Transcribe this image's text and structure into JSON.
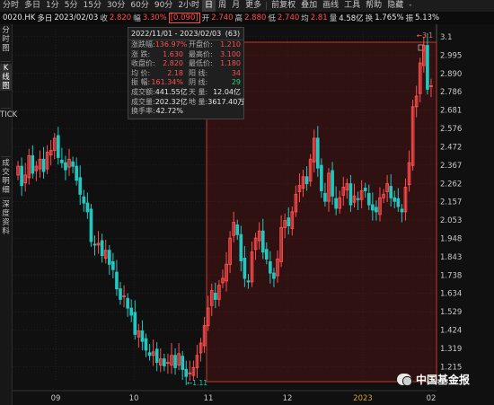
{
  "toolbar": {
    "items": [
      "分时",
      "多日",
      "1分",
      "5分",
      "15分",
      "30分",
      "60分",
      "90分",
      "2小时",
      "日",
      "周",
      "月",
      "更多"
    ],
    "selected_index": 9,
    "right_items": [
      "前复权",
      "叠加",
      "画线",
      "工具",
      "帮助",
      "隐藏"
    ],
    "hide_arrow": "-"
  },
  "infobar": {
    "code": "0020.HK",
    "mode": "多日",
    "date": "2023/02/03",
    "close_label": "收",
    "close": "2.820",
    "change_label": "幅",
    "change": "3.30%",
    "change_amt": "[0.090]",
    "open_label": "开",
    "open": "2.740",
    "high_label": "高",
    "high": "2.880",
    "low_label": "低",
    "low": "2.740",
    "avg_label": "均",
    "avg": "2.81",
    "vol_label": "量",
    "vol": "4.58亿",
    "turnover_label": "换",
    "turnover": "1.765%",
    "amp_label": "振",
    "amp": "5.13%"
  },
  "sidebar": {
    "tabs": [
      {
        "label": "分时图"
      },
      {
        "label": "K线图",
        "active": true
      },
      {
        "label": "TICK"
      },
      {
        "label": "成交明细"
      },
      {
        "label": "深度资料"
      }
    ]
  },
  "tooltip": {
    "range": "2022/11/01 - 2023/02/03",
    "count": "(63)",
    "rows": [
      [
        {
          "label": "涨跌幅:",
          "value": "136.97%",
          "c": "red"
        },
        {
          "label": "开盘价:",
          "value": "1.210",
          "c": "red"
        }
      ],
      [
        {
          "label": "涨  跌:",
          "value": "1.630",
          "c": "red"
        },
        {
          "label": "最高价:",
          "value": "3.100",
          "c": "red"
        }
      ],
      [
        {
          "label": "收盘价:",
          "value": "2.820",
          "c": "red"
        },
        {
          "label": "最低价:",
          "value": "1.180",
          "c": "red"
        }
      ],
      [
        {
          "label": "均  价:",
          "value": "2.18",
          "c": "red"
        },
        {
          "label": "阳  线:",
          "value": "34",
          "c": "red"
        }
      ],
      [
        {
          "label": "振  幅:",
          "value": "161.34%",
          "c": "red"
        },
        {
          "label": "阴  线:",
          "value": "29",
          "c": "grn"
        }
      ],
      [
        {
          "label": "成交额:",
          "value": "441.55亿",
          "c": "wht"
        },
        {
          "label": "天  量:",
          "value": "12.04亿",
          "c": "wht"
        }
      ],
      [
        {
          "label": "成交量:",
          "value": "202.32亿",
          "c": "wht"
        },
        {
          "label": "地  量:",
          "value": "3617.40万",
          "c": "wht"
        }
      ],
      [
        {
          "label": "换手率:",
          "value": "42.72%",
          "c": "wht"
        }
      ]
    ]
  },
  "watermark": {
    "text": "中国基金报"
  },
  "colors": {
    "up": "#ff4d4d",
    "down": "#22c8c0",
    "selection": "#c0392b",
    "grid": "#2a2a2a"
  },
  "chart_data": {
    "type": "candlestick",
    "y_ticks": [
      "3.1",
      "2.995",
      "2.890",
      "2.786",
      "2.681",
      "2.576",
      "2.472",
      "2.367",
      "2.262",
      "2.157",
      "2.053",
      "1.948",
      "1.843",
      "1.738",
      "1.634",
      "1.529",
      "1.424",
      "1.319",
      "1.215"
    ],
    "x_ticks": [
      "09",
      "10",
      "11",
      "12",
      "2023",
      "02"
    ],
    "high_marker": "3.1",
    "low_marker": "1.11",
    "selection_range": [
      "2022/11/01",
      "2023/02/03"
    ],
    "series": [
      {
        "name": "close",
        "values": [
          2.36,
          2.25,
          2.31,
          2.42,
          2.32,
          2.36,
          2.4,
          2.33,
          2.44,
          2.45,
          2.52,
          2.41,
          2.38,
          2.34,
          2.4,
          2.36,
          2.28,
          2.2,
          2.15,
          2.1,
          1.93,
          1.91,
          1.92,
          1.85,
          1.88,
          1.8,
          1.77,
          1.66,
          1.6,
          1.62,
          1.55,
          1.51,
          1.4,
          1.42,
          1.36,
          1.31,
          1.28,
          1.3,
          1.24,
          1.26,
          1.22,
          1.24,
          1.28,
          1.21,
          1.29,
          1.2,
          1.16,
          1.18,
          1.21,
          1.28,
          1.35,
          1.45,
          1.55,
          1.65,
          1.6,
          1.68,
          1.72,
          1.8,
          1.95,
          2.04,
          1.97,
          1.82,
          1.72,
          1.7,
          1.87,
          1.95,
          1.99,
          1.87,
          1.83,
          1.75,
          1.72,
          1.83,
          2.01,
          2.05,
          2.02,
          2.1,
          2.2,
          2.25,
          2.3,
          2.26,
          2.4,
          2.52,
          2.35,
          2.22,
          2.16,
          2.32,
          2.19,
          2.12,
          2.18,
          2.24,
          2.26,
          2.14,
          2.19,
          2.17,
          2.22,
          2.22,
          2.14,
          2.11,
          2.1,
          2.18,
          2.2,
          2.26,
          2.18,
          2.16,
          2.13,
          2.1,
          2.24,
          2.38,
          2.7,
          2.76,
          2.95,
          3.05,
          2.8,
          2.82
        ]
      }
    ]
  }
}
